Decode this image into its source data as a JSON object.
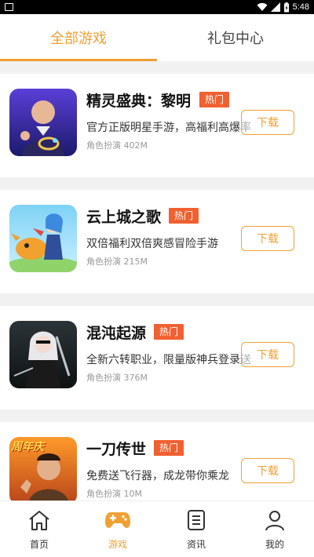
{
  "status_bar": {
    "time": "5:48",
    "battery_icon": "battery-charging-icon",
    "signal_icon": "cell-signal-icon",
    "wifi_icon": "wifi-icon"
  },
  "tabs": [
    {
      "label": "全部游戏",
      "active": true
    },
    {
      "label": "礼包中心",
      "active": false
    }
  ],
  "games": [
    {
      "title": "精灵盛典：黎明",
      "badge": "热门",
      "desc": "官方正版明星手游，高福利高爆率",
      "meta": "角色扮演 402M",
      "download_label": "下载"
    },
    {
      "title": "云上城之歌",
      "badge": "热门",
      "desc": "双倍福利双倍爽感冒险手游",
      "meta": "角色扮演 215M",
      "download_label": "下载"
    },
    {
      "title": "混沌起源",
      "badge": "热门",
      "desc": "全新六转职业，限量版神兵登录送",
      "meta": "角色扮演 376M",
      "download_label": "下载"
    },
    {
      "title": "一刀传世",
      "badge": "热门",
      "desc": "免费送飞行器，成龙带你乘龙",
      "meta": "角色扮演 10M",
      "download_label": "下载",
      "thumb_text": "周年庆"
    }
  ],
  "bottom_nav": [
    {
      "label": "首页",
      "icon": "home-icon",
      "active": false
    },
    {
      "label": "游戏",
      "icon": "gamepad-icon",
      "active": true
    },
    {
      "label": "资讯",
      "icon": "news-icon",
      "active": false
    },
    {
      "label": "我的",
      "icon": "user-icon",
      "active": false
    }
  ],
  "colors": {
    "accent": "#f0a033",
    "badge": "#f06030",
    "separator": "#f1f1f1"
  }
}
